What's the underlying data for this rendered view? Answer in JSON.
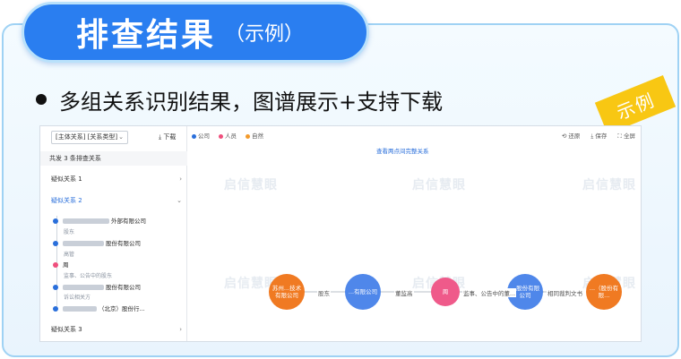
{
  "header": {
    "title": "排查结果",
    "subtitle": "（示例）"
  },
  "bullet": "多组关系识别结果，图谱展示+支持下载",
  "example_tag": "示例",
  "panel": {
    "select_value": "[主体关系] [关系类型]",
    "download_label": "下载",
    "count_text": "共发 3 条排查关系",
    "sections": [
      {
        "label": "疑似关系 1",
        "active": false
      },
      {
        "label": "疑似关系 2",
        "active": true
      },
      {
        "label": "疑似关系 3",
        "active": false
      }
    ],
    "timeline": {
      "items": [
        {
          "text": "外部有限公司",
          "color": "#2a6fdb"
        },
        {
          "text": "股份有限公司",
          "color": "#2a6fdb"
        },
        {
          "text": "周",
          "color": "#ef4f7d"
        },
        {
          "text": "股份有限公司",
          "color": "#2a6fdb"
        },
        {
          "text": "（北京）股份行...",
          "color": "#2a6fdb"
        }
      ],
      "subs": [
        "股东",
        "高管",
        "监事、公告中的股东",
        "诉讼相关方"
      ]
    },
    "legend": [
      {
        "label": "公司",
        "color": "#2a6fdb"
      },
      {
        "label": "人员",
        "color": "#ef4f7d"
      },
      {
        "label": "自然",
        "color": "#f39a2b"
      }
    ],
    "toolbar": [
      "还原",
      "保存",
      "全屏"
    ],
    "view_link": "查看两点间完整关系",
    "nodes": [
      {
        "label": "苏州...技术有限公司",
        "color": "#f07a22"
      },
      {
        "label": "...有限公司",
        "color": "#4f87ea"
      },
      {
        "label": "周",
        "color": "#ef5a8a"
      },
      {
        "label": "...股份有限公司",
        "color": "#4f87ea"
      },
      {
        "label": "...（股份有限...",
        "color": "#f07a22"
      }
    ],
    "edges": [
      "股东",
      "董监高",
      "监事、公告中的董...",
      "相同裁判文书"
    ],
    "watermark": "启信慧眼"
  }
}
